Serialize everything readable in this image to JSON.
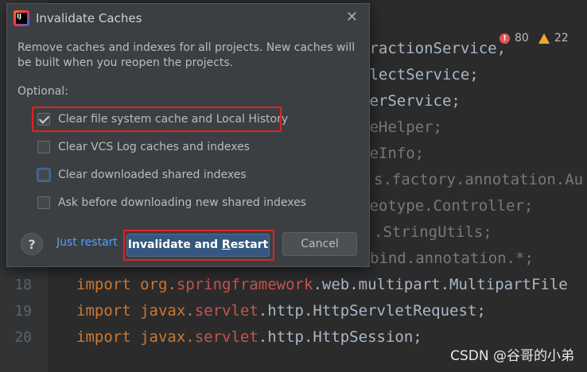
{
  "editor": {
    "lines": [
      {
        "num": "",
        "text": "tractionService,"
      },
      {
        "num": "",
        "text": "llectService;"
      },
      {
        "num": "",
        "text": "derService;"
      },
      {
        "num": "",
        "text": "geHelper;"
      },
      {
        "num": "",
        "text": "geInfo;"
      },
      {
        "num": "",
        "text": "s.factory.annotation.Au"
      },
      {
        "num": "",
        "text": "reotype.Controller;"
      },
      {
        "num": "",
        "text": ".StringUtils;"
      },
      {
        "num": "",
        "text": "bind.annotation.*;"
      }
    ],
    "line18": {
      "num": "18",
      "pre": "import org.",
      "hl": "springframework",
      "post": ".web.multipart.MultipartFile"
    },
    "line19": {
      "num": "19",
      "pre": "import javax.",
      "hl": "servlet",
      "post": ".http.HttpServletRequest;"
    },
    "line20": {
      "num": "20",
      "pre": "import javax.",
      "hl": "servlet",
      "post": ".http.HttpSession;"
    },
    "errors": "80",
    "warnings": "22",
    "colors": {
      "background": "#2b2b2b",
      "code": "#a9b7c6",
      "keyword": "#cc7832",
      "highlight": "#c75450"
    }
  },
  "watermark": "CSDN @谷哥的小弟",
  "dialog": {
    "title": "Invalidate Caches",
    "description": "Remove caches and indexes for all projects. New caches will be built when you reopen the projects.",
    "optional_label": "Optional:",
    "options": [
      {
        "label": "Clear file system cache and Local History",
        "checked": true
      },
      {
        "label": "Clear VCS Log caches and indexes",
        "checked": false
      },
      {
        "label": "Clear downloaded shared indexes",
        "checked": false
      },
      {
        "label": "Ask before downloading new shared indexes",
        "checked": false
      }
    ],
    "help_label": "?",
    "just_restart": "Just restart",
    "primary_pre": "Invalidate and ",
    "primary_ul": "R",
    "primary_post": "estart",
    "cancel": "Cancel",
    "colors": {
      "dialog_bg": "#3c3f41",
      "primary_button": "#365880",
      "link": "#589df6",
      "annotation_box": "#e02323"
    }
  }
}
